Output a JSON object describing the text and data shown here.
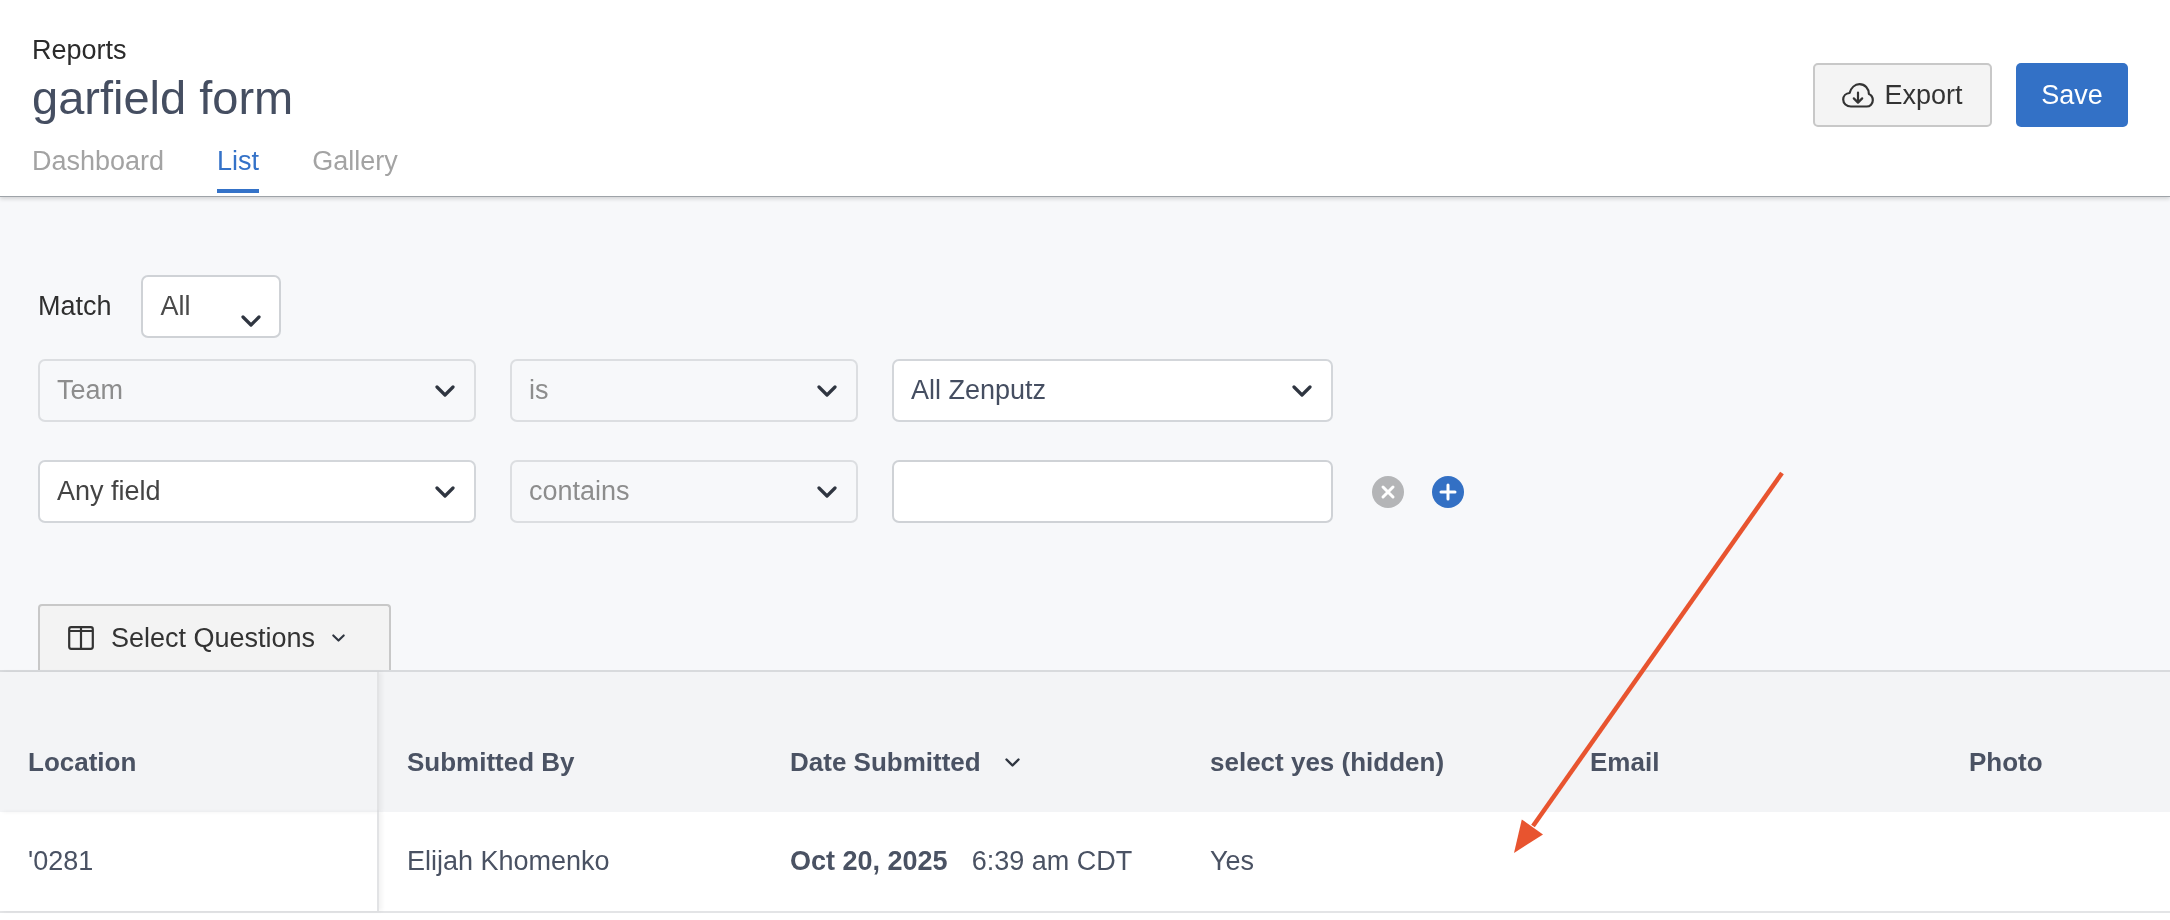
{
  "header": {
    "breadcrumb": "Reports",
    "title": "garfield form",
    "tabs": [
      {
        "label": "Dashboard",
        "selected": false
      },
      {
        "label": "List",
        "selected": true
      },
      {
        "label": "Gallery",
        "selected": false
      }
    ],
    "actions": [
      {
        "kind": "export",
        "label": "Export"
      },
      {
        "kind": "save",
        "label": "Save"
      }
    ]
  },
  "filters": {
    "match": {
      "label": "Match",
      "value": "All"
    },
    "conditions": [
      {
        "field": {
          "value": "Team",
          "disabled": true
        },
        "operator": {
          "value": "is",
          "disabled": true
        },
        "value": {
          "kind": "select",
          "value": "All Zenputz"
        },
        "removable": false,
        "addable": false
      },
      {
        "field": {
          "value": "Any field",
          "disabled": false
        },
        "operator": {
          "value": "contains",
          "disabled": true
        },
        "value": {
          "kind": "input"
        },
        "removable": true,
        "addable": true
      }
    ]
  },
  "select_questions": {
    "label": "Select Questions"
  },
  "table": {
    "columns": [
      {
        "label": "Location",
        "sorted": false
      },
      {
        "label": "Submitted By",
        "sorted": false
      },
      {
        "label": "Date Submitted",
        "sorted": true
      },
      {
        "label": "select yes (hidden)",
        "sorted": false
      },
      {
        "label": "Email",
        "sorted": false
      },
      {
        "label": "Photo",
        "sorted": false
      }
    ],
    "rows": [
      {
        "cells": [
          {
            "kind": "text",
            "text": "'0281"
          },
          {
            "kind": "text",
            "text": "Elijah Khomenko"
          },
          {
            "kind": "datetime",
            "date": "Oct 20, 2025",
            "time": "6:39 am CDT"
          },
          {
            "kind": "text",
            "text": "Yes"
          }
        ]
      }
    ]
  }
}
